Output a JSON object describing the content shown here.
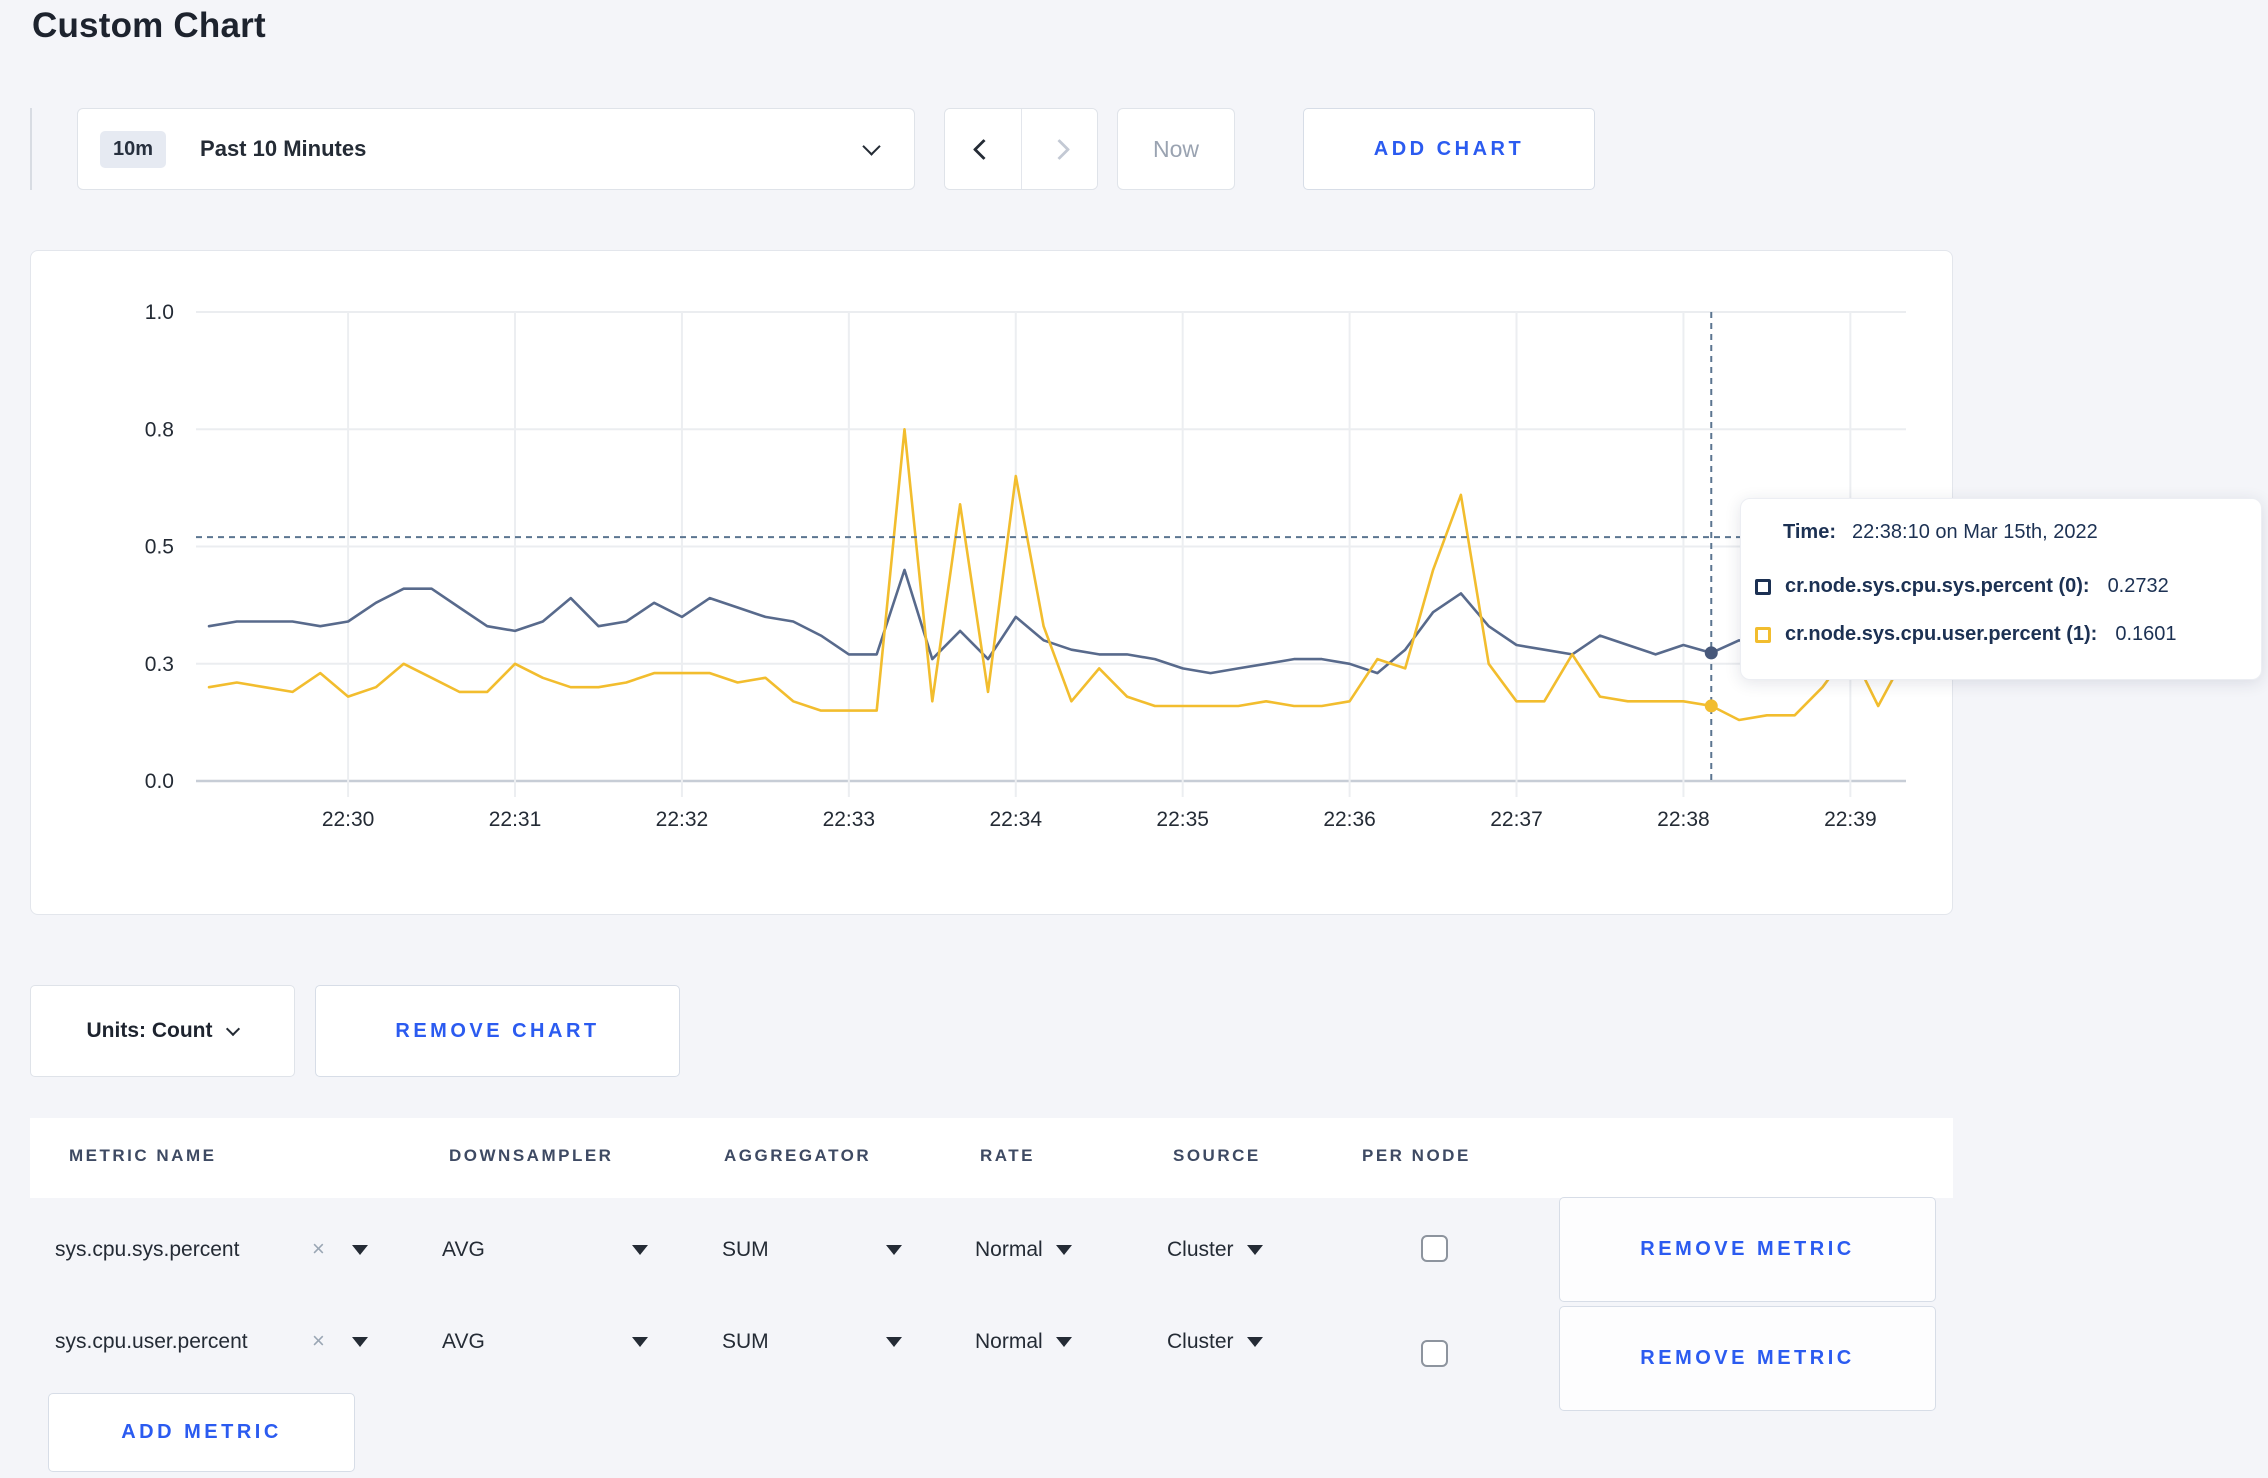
{
  "page": {
    "title": "Custom Chart"
  },
  "toolbar": {
    "time_badge": "10m",
    "time_label": "Past 10 Minutes",
    "now_label": "Now",
    "add_chart_label": "ADD CHART"
  },
  "tooltip": {
    "time_label": "Time:",
    "time_value": "22:38:10 on Mar 15th, 2022",
    "rows": [
      {
        "label": "cr.node.sys.cpu.sys.percent (0):",
        "value": "0.2732",
        "swatch": "#1c3153"
      },
      {
        "label": "cr.node.sys.cpu.user.percent (1):",
        "value": "0.1601",
        "swatch": "#f2bd2e"
      }
    ]
  },
  "units_bar": {
    "units_label": "Units: Count",
    "remove_chart_label": "REMOVE CHART"
  },
  "metrics_table": {
    "headers": [
      "METRIC NAME",
      "DOWNSAMPLER",
      "AGGREGATOR",
      "RATE",
      "SOURCE",
      "PER NODE"
    ],
    "rows": [
      {
        "name": "sys.cpu.sys.percent",
        "clear": "×",
        "downsampler": "AVG",
        "aggregator": "SUM",
        "rate": "Normal",
        "source": "Cluster",
        "per_node_checked": false,
        "remove_label": "REMOVE METRIC"
      },
      {
        "name": "sys.cpu.user.percent",
        "clear": "×",
        "downsampler": "AVG",
        "aggregator": "SUM",
        "rate": "Normal",
        "source": "Cluster",
        "per_node_checked": false,
        "remove_label": "REMOVE METRIC"
      }
    ],
    "add_metric_label": "ADD METRIC"
  },
  "chart_data": {
    "type": "line",
    "title": "",
    "xlabel": "",
    "ylabel": "",
    "ylim": [
      0.0,
      1.0
    ],
    "grid": true,
    "x_start": "22:29:10",
    "x_step_seconds": 10,
    "x_tick_labels": [
      "22:30",
      "22:31",
      "22:32",
      "22:33",
      "22:34",
      "22:35",
      "22:36",
      "22:37",
      "22:38",
      "22:39"
    ],
    "x_tick_indices": [
      5,
      11,
      17,
      23,
      29,
      35,
      41,
      47,
      53,
      59
    ],
    "y_ticks": [
      {
        "v": 0.0,
        "label": "0.0"
      },
      {
        "v": 0.25,
        "label": "0.3"
      },
      {
        "v": 0.5,
        "label": "0.5"
      },
      {
        "v": 0.75,
        "label": "0.8"
      },
      {
        "v": 1.0,
        "label": "1.0"
      }
    ],
    "series": [
      {
        "name": "cr.node.sys.cpu.sys.percent",
        "color": "#586a8c",
        "dot_color": "#47587a",
        "values": [
          0.33,
          0.34,
          0.34,
          0.34,
          0.33,
          0.34,
          0.38,
          0.41,
          0.41,
          0.37,
          0.33,
          0.32,
          0.34,
          0.39,
          0.33,
          0.34,
          0.38,
          0.35,
          0.39,
          0.37,
          0.35,
          0.34,
          0.31,
          0.27,
          0.27,
          0.45,
          0.26,
          0.32,
          0.26,
          0.35,
          0.3,
          0.28,
          0.27,
          0.27,
          0.26,
          0.24,
          0.23,
          0.24,
          0.25,
          0.26,
          0.26,
          0.25,
          0.23,
          0.28,
          0.36,
          0.4,
          0.33,
          0.29,
          0.28,
          0.27,
          0.31,
          0.29,
          0.27,
          0.29,
          0.2732,
          0.3,
          0.28,
          0.27,
          0.29,
          0.31,
          0.3,
          0.31
        ]
      },
      {
        "name": "cr.node.sys.cpu.user.percent",
        "color": "#f2bd2e",
        "dot_color": "#f2bd2e",
        "values": [
          0.2,
          0.21,
          0.2,
          0.19,
          0.23,
          0.18,
          0.2,
          0.25,
          0.22,
          0.19,
          0.19,
          0.25,
          0.22,
          0.2,
          0.2,
          0.21,
          0.23,
          0.23,
          0.23,
          0.21,
          0.22,
          0.17,
          0.15,
          0.15,
          0.15,
          0.75,
          0.17,
          0.59,
          0.19,
          0.65,
          0.33,
          0.17,
          0.24,
          0.18,
          0.16,
          0.16,
          0.16,
          0.16,
          0.17,
          0.16,
          0.16,
          0.17,
          0.26,
          0.24,
          0.45,
          0.61,
          0.25,
          0.17,
          0.17,
          0.27,
          0.18,
          0.17,
          0.17,
          0.17,
          0.1601,
          0.13,
          0.14,
          0.14,
          0.2,
          0.28,
          0.16,
          0.27
        ]
      }
    ],
    "legend_position": "tooltip",
    "crosshair": {
      "index": 54,
      "time_label": "22:38:10",
      "y_value": 0.52
    }
  }
}
